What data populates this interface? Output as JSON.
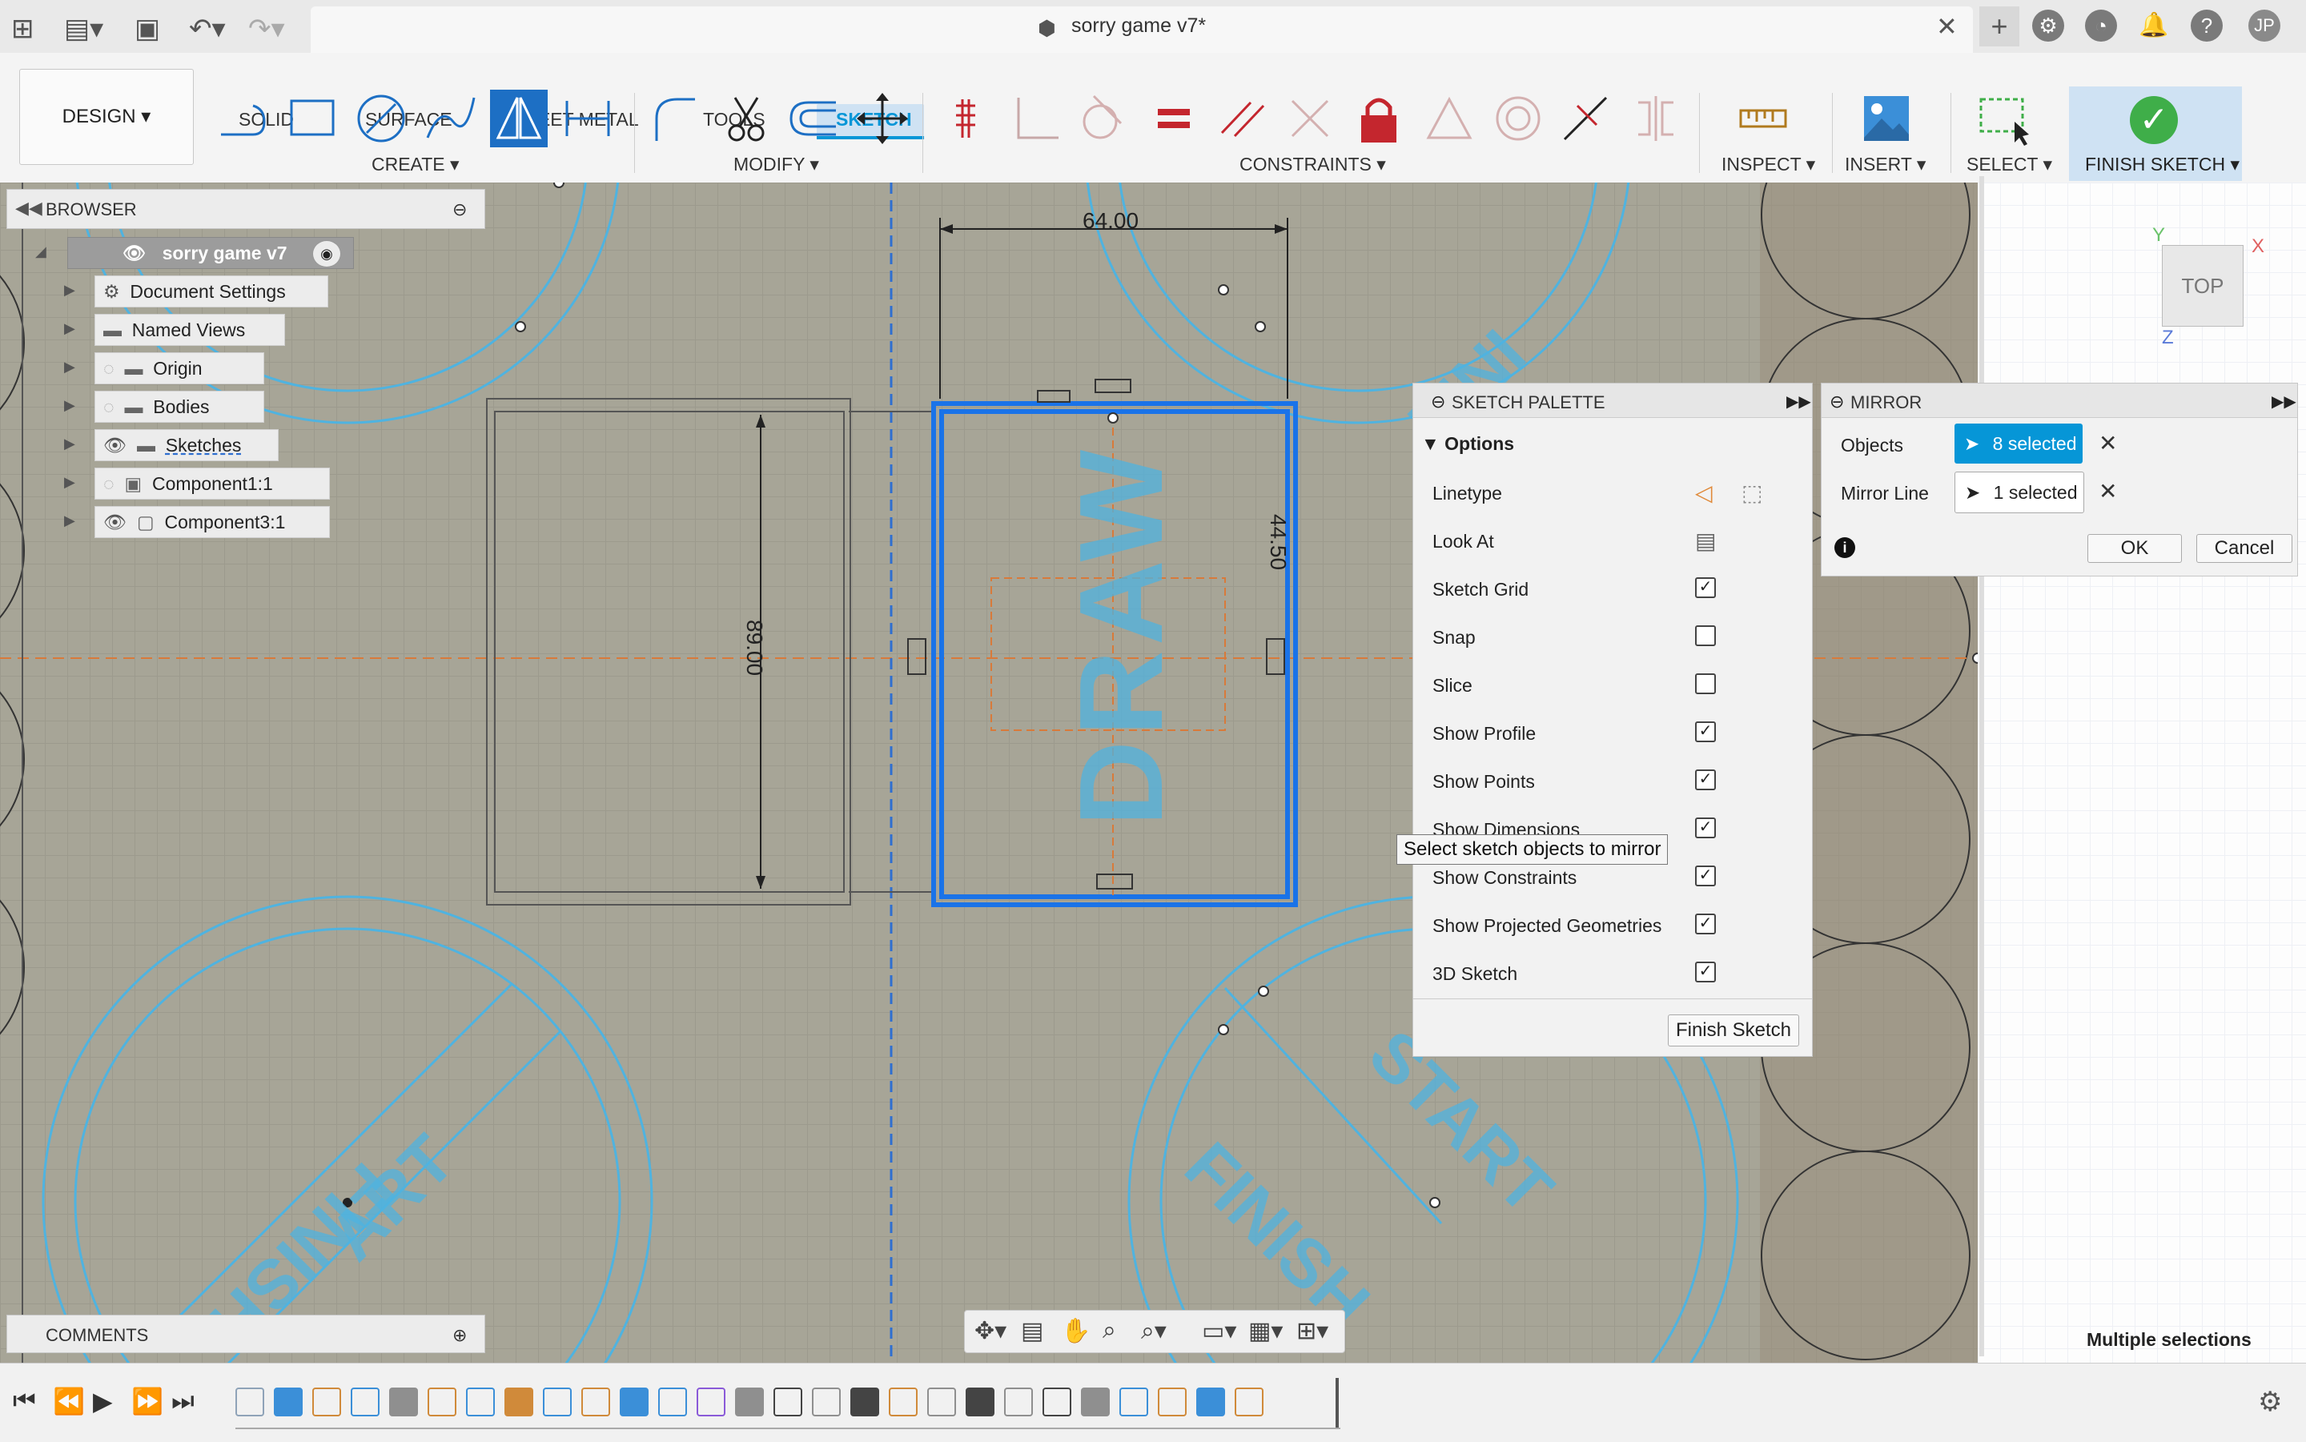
{
  "window": {
    "title": "sorry game v7*"
  },
  "user": {
    "initials": "JP"
  },
  "toolbar": {
    "workspace": "DESIGN",
    "tabs": [
      "SOLID",
      "SURFACE",
      "SHEET METAL",
      "TOOLS",
      "SKETCH"
    ],
    "groups": {
      "create": "CREATE",
      "modify": "MODIFY",
      "constraints": "CONSTRAINTS",
      "inspect": "INSPECT",
      "insert": "INSERT",
      "select": "SELECT",
      "finish": "FINISH SKETCH"
    }
  },
  "browser": {
    "title": "BROWSER",
    "root": "sorry game v7",
    "items": [
      "Document Settings",
      "Named Views",
      "Origin",
      "Bodies",
      "Sketches",
      "Component1:1",
      "Component3:1"
    ]
  },
  "comments": {
    "title": "COMMENTS"
  },
  "canvas": {
    "dim_width": "64.00",
    "dim_height": "44.50",
    "dim_rect_height": "89.00",
    "label_draw": "DRAW",
    "label_finish": "FINISH",
    "label_start": "START",
    "label_start_partial": "ART",
    "label_finish_partial": "FINI"
  },
  "viewcube": {
    "face": "TOP",
    "axis_x": "X",
    "axis_y": "Y",
    "axis_z": "Z"
  },
  "sketch_palette": {
    "title": "SKETCH PALETTE",
    "section": "Options",
    "rows": [
      {
        "label": "Linetype",
        "checked": null
      },
      {
        "label": "Look At",
        "checked": null
      },
      {
        "label": "Sketch Grid",
        "checked": true
      },
      {
        "label": "Snap",
        "checked": false
      },
      {
        "label": "Slice",
        "checked": false
      },
      {
        "label": "Show Profile",
        "checked": true
      },
      {
        "label": "Show Points",
        "checked": true
      },
      {
        "label": "Show Dimensions",
        "checked": true
      },
      {
        "label": "Show Constraints",
        "checked": true
      },
      {
        "label": "Show Projected Geometries",
        "checked": true
      },
      {
        "label": "3D Sketch",
        "checked": true
      }
    ],
    "finish_button": "Finish Sketch"
  },
  "tooltip": "Select sketch objects to mirror",
  "mirror": {
    "title": "MIRROR",
    "objects_label": "Objects",
    "objects_value": "8 selected",
    "mirror_line_label": "Mirror Line",
    "mirror_line_value": "1 selected",
    "ok": "OK",
    "cancel": "Cancel"
  },
  "status": "Multiple selections",
  "colors": {
    "accent": "#0696d7",
    "selection": "#1a73e8",
    "sketch_line": "#4fb3e0",
    "title_bar": "#e9e9e9"
  }
}
